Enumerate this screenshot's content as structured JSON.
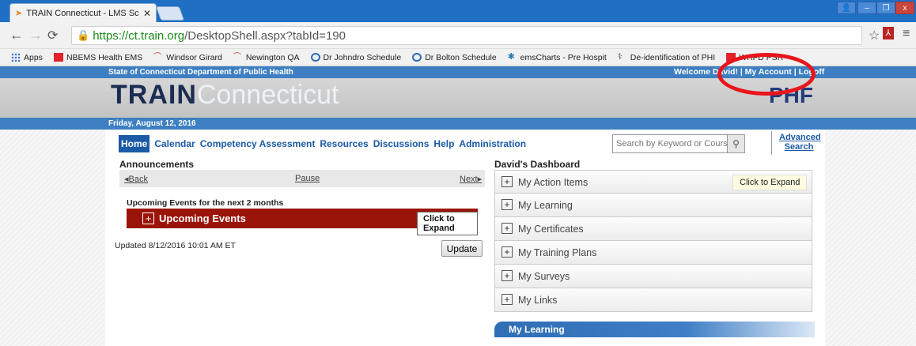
{
  "browser": {
    "tab_title": "TRAIN Connecticut - LMS Sc",
    "url_secure": "https://ct.train.org",
    "url_rest": "/DesktopShell.aspx?tabId=190",
    "bookmarks": [
      {
        "label": "Apps",
        "color": "#3b6fd6"
      },
      {
        "label": "NBEMS Health EMS",
        "color": "#e0242a"
      },
      {
        "label": "Windsor Girard",
        "color": "#c0392b"
      },
      {
        "label": "Newington QA",
        "color": "#c0392b"
      },
      {
        "label": "Dr Johndro Schedule",
        "color": "#2f6db5"
      },
      {
        "label": "Dr Bolton Schedule",
        "color": "#2f6db5"
      },
      {
        "label": "emsCharts - Pre Hospit",
        "color": "#2a7ab0"
      },
      {
        "label": "De-identification of PHI",
        "color": "#444444"
      },
      {
        "label": "WHFD PSR",
        "color": "#e0242a"
      }
    ]
  },
  "header": {
    "state_dept": "State of Connecticut Department of Public Health",
    "welcome": "Welcome David! | My Account | Logoff",
    "logo_bold": "TRAIN",
    "logo_light": "Connecticut",
    "partner_logo": "PHF",
    "date": "Friday, August 12, 2016"
  },
  "nav": {
    "items": [
      "Home",
      "Calendar",
      "Competency Assessment",
      "Resources",
      "Discussions",
      "Help",
      "Administration"
    ],
    "search_placeholder": "Search by Keyword or Course ID",
    "advanced_search": "Advanced Search"
  },
  "announcements": {
    "title": "Announcements",
    "back": "Back",
    "pause": "Pause",
    "next": "Next",
    "upcoming_sub": "Upcoming Events for the next 2 months",
    "events_label": "Upcoming Events",
    "expand_label": "Click to Expand",
    "updated": "Updated 8/12/2016 10:01 AM ET",
    "update_button": "Update"
  },
  "dashboard": {
    "title": "David's Dashboard",
    "expand_label": "Click to Expand",
    "rows": [
      "My Action Items",
      "My Learning",
      "My Certificates",
      "My Training Plans",
      "My Surveys",
      "My Links"
    ],
    "section_bar": "My Learning"
  },
  "colors": {
    "accent": "#1b5aa6",
    "event_bar": "#9b140a",
    "highlight_circle": "#e8161b"
  }
}
